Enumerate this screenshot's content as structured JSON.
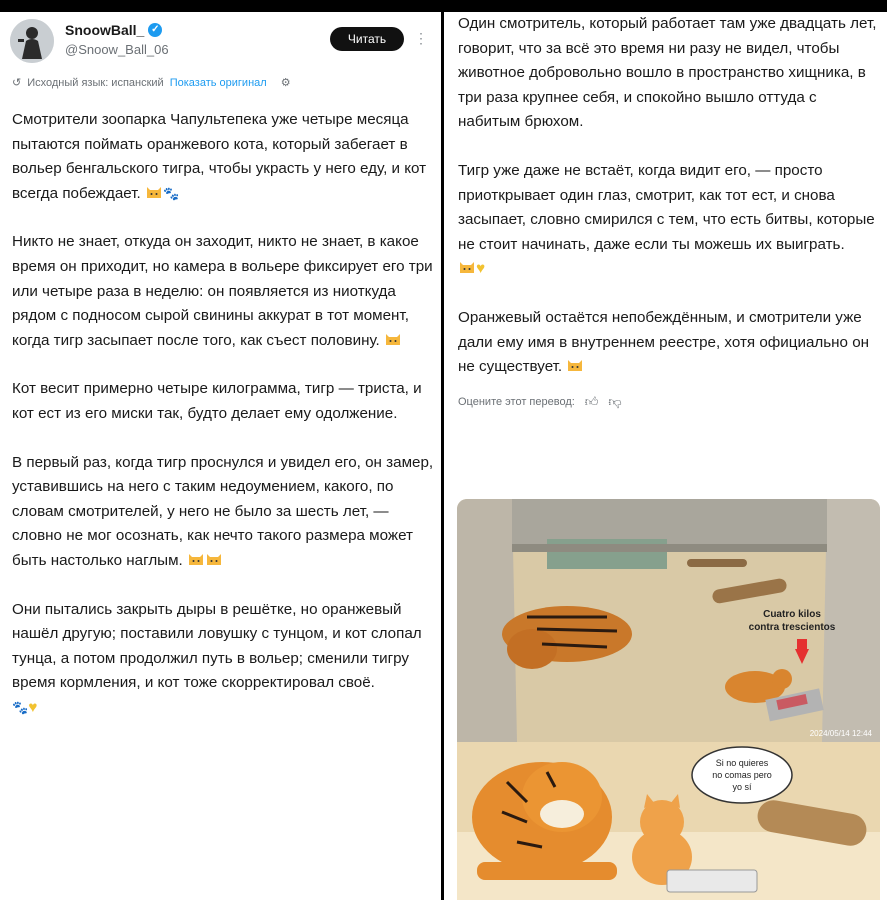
{
  "header": {
    "display_name": "SnoowBall_",
    "handle": "@Snoow_Ball_06",
    "follow_label": "Читать",
    "more_icon": "⋮"
  },
  "translation": {
    "original_lang": "Исходный язык: испанский",
    "show_original": "Показать оригинал",
    "rate_label": "Оцените этот перевод:"
  },
  "post": {
    "left_paragraphs": [
      "Смотрители зоопарка Чапультепека уже четыре месяца пытаются поймать оранжевого кота, который забегает в вольер бенгальского тигра, чтобы украсть у него еду, и кот всегда побеждает.",
      "Никто не знает, откуда он заходит, никто не знает, в какое время он приходит, но камера в вольере фиксирует его три или четыре раза в неделю: он появляется из ниоткуда рядом с подносом сырой свинины аккурат в тот момент, когда тигр засыпает после того, как съест половину.",
      "Кот весит примерно четыре килограмма, тигр — триста, и кот ест из его миски так, будто делает ему одолжение.",
      "В первый раз, когда тигр проснулся и увидел его, он замер, уставившись на него с таким недоумением, какого, по словам смотрителей, у него не было за шесть лет, — словно не мог осознать, как нечто такого размера может быть настолько наглым.",
      "Они пытались закрыть дыры в решётке, но оранжевый нашёл другую; поставили ловушку с тунцом, и кот слопал тунца, а потом продолжил путь в вольер; сменили тигру время кормления, и кот тоже скорректировал своё."
    ],
    "right_paragraphs": [
      "Один смотритель, который работает там уже двадцать лет, говорит, что за всё это время ни разу не видел, чтобы животное добровольно вошло в пространство хищника, в три раза крупнее себя, и спокойно вышло оттуда с набитым брюхом.",
      "Тигр уже даже не встаёт, когда видит его, — просто приоткрывает один глаз, смотрит, как тот ест, и снова засыпает, словно смирился с тем, что есть битвы, которые не стоит начинать, даже если ты можешь их выиграть.",
      "Оранжевый остаётся непобеждённым, и смотрители уже дали ему имя в внутреннем реестре, хотя официально он не существует."
    ]
  },
  "media": {
    "photo_caption_line1": "Cuatro kilos",
    "photo_caption_line2": "contra trescientos",
    "photo_timestamp": "2024/05/14 12:44",
    "comic_bubble_line1": "Si no quieres",
    "comic_bubble_line2": "no comas pero",
    "comic_bubble_line3": "yo sí"
  },
  "icons": [
    "avatar",
    "verified-badge-icon",
    "translate-icon",
    "settings-icon",
    "thumbs-up-icon",
    "thumbs-down-icon",
    "cat-emoji-icon",
    "paw-emoji-icon",
    "heart-emoji-icon"
  ],
  "colors": {
    "link": "#1d9bf0",
    "follow_bg": "#111111",
    "muted": "#6b7075"
  }
}
